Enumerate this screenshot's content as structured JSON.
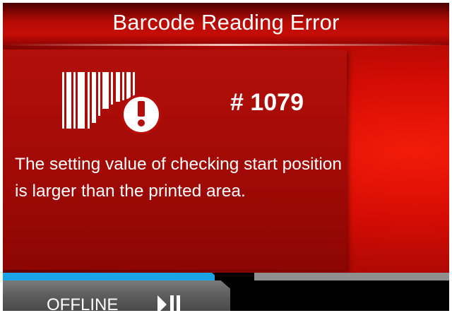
{
  "dialog": {
    "title": "Barcode Reading Error",
    "error_code": "# 1079",
    "message": "The setting value of checking start position is larger than the printed area.",
    "icon": "barcode-error-icon"
  },
  "status_bar": {
    "status_label": "OFFLINE",
    "icon": "play-pause-icon"
  },
  "colors": {
    "error_red": "#c50d06",
    "status_blue": "#1aa6e6",
    "tab_gray": "#5d5d5d"
  }
}
